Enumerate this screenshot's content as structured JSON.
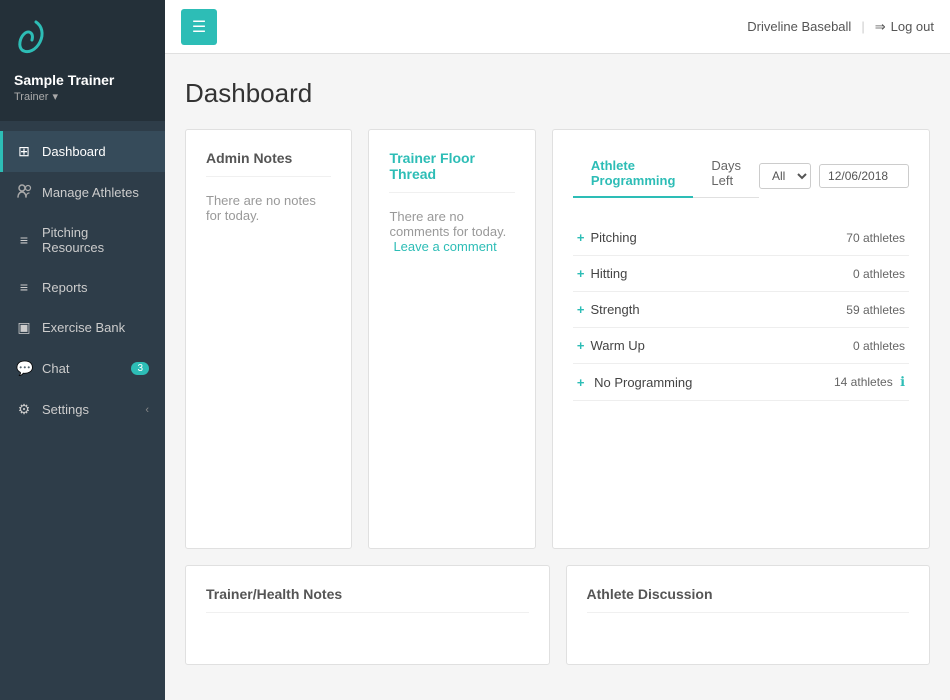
{
  "sidebar": {
    "logo_icon": ")",
    "username": "Sample Trainer",
    "role": "Trainer",
    "items": [
      {
        "id": "dashboard",
        "label": "Dashboard",
        "icon": "⊞",
        "active": true,
        "badge": null
      },
      {
        "id": "manage-athletes",
        "label": "Manage Athletes",
        "icon": "👥",
        "active": false,
        "badge": null
      },
      {
        "id": "pitching-resources",
        "label": "Pitching Resources",
        "icon": "≡",
        "active": false,
        "badge": null
      },
      {
        "id": "reports",
        "label": "Reports",
        "icon": "≡",
        "active": false,
        "badge": null
      },
      {
        "id": "exercise-bank",
        "label": "Exercise Bank",
        "icon": "▣",
        "active": false,
        "badge": null
      },
      {
        "id": "chat",
        "label": "Chat",
        "icon": "💬",
        "active": false,
        "badge": "3"
      },
      {
        "id": "settings",
        "label": "Settings",
        "icon": "⚙",
        "active": false,
        "badge": null,
        "chevron": "‹"
      }
    ]
  },
  "topbar": {
    "menu_icon": "☰",
    "brand": "Driveline Baseball",
    "logout_icon": "→",
    "logout_label": "Log out"
  },
  "page": {
    "title": "Dashboard"
  },
  "admin_notes": {
    "title": "Admin Notes",
    "empty_message": "There are no notes for today."
  },
  "trainer_floor": {
    "title": "Trainer Floor Thread",
    "empty_message": "There are no comments for today.",
    "leave_comment_label": "Leave a comment"
  },
  "athlete_programming": {
    "tabs": [
      {
        "id": "programming",
        "label": "Athlete Programming",
        "active": true
      },
      {
        "id": "days-left",
        "label": "Days Left",
        "active": false
      }
    ],
    "filter_options": [
      "All"
    ],
    "filter_selected": "All",
    "date_value": "12/06/2018",
    "rows": [
      {
        "id": "pitching",
        "label": "Pitching",
        "count": "70 athletes",
        "has_info": false
      },
      {
        "id": "hitting",
        "label": "Hitting",
        "count": "0 athletes",
        "has_info": false
      },
      {
        "id": "strength",
        "label": "Strength",
        "count": "59 athletes",
        "has_info": false
      },
      {
        "id": "warm-up",
        "label": "Warm Up",
        "count": "0 athletes",
        "has_info": false
      },
      {
        "id": "no-programming",
        "label": "No Programming",
        "count": "14 athletes",
        "has_info": true
      }
    ]
  },
  "trainer_health": {
    "title": "Trainer/Health Notes"
  },
  "athlete_discussion": {
    "title": "Athlete Discussion"
  }
}
